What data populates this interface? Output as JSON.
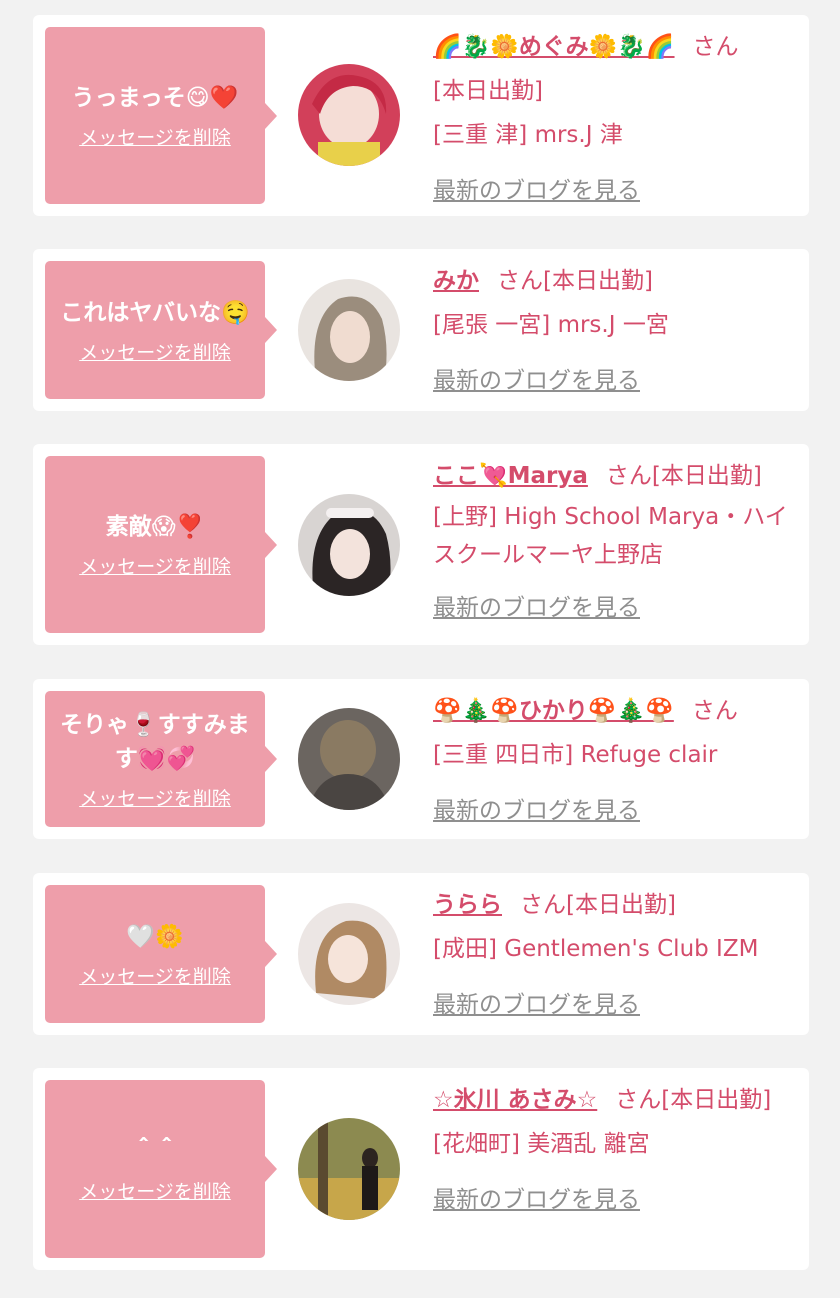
{
  "delete_label": "メッセージを削除",
  "blog_label": "最新のブログを見る",
  "colors": {
    "accent": "#d44c6b",
    "bubble": "#ee9eaa",
    "link_gray": "#8f8f8f",
    "background": "#f2f2f2"
  },
  "cards": [
    {
      "message": "うっまっそ😋❤️",
      "name": "🌈🐉🌼めぐみ🌼🐉🌈",
      "san": "さん",
      "status": "[本日出勤]",
      "shop": "[三重 津] mrs.J 津"
    },
    {
      "message": "これはヤバいな🤤",
      "name": "みか",
      "san": "さん",
      "status": "[本日出勤]",
      "shop": "[尾張 一宮] mrs.J 一宮"
    },
    {
      "message": "素敵😱❣️",
      "name": "ここ💘Marya",
      "san": "さん",
      "status": "[本日出勤]",
      "shop": "[上野] High School Marya・ハイスクールマーヤ上野店"
    },
    {
      "message": "そりゃ🍷すすみます💓💞",
      "name": "🍄🎄🍄ひかり🍄🎄🍄",
      "san": "さん",
      "status": "",
      "shop": "[三重 四日市] Refuge clair"
    },
    {
      "message": "🤍🌼",
      "name": "うらら",
      "san": "さん",
      "status": "[本日出勤]",
      "shop": "[成田] Gentlemen's Club IZM"
    },
    {
      "message": "＾＾",
      "name": "☆氷川 あさみ☆",
      "san": "さん",
      "status": "[本日出勤]",
      "shop": "[花畑町] 美酒乱 離宮"
    }
  ]
}
